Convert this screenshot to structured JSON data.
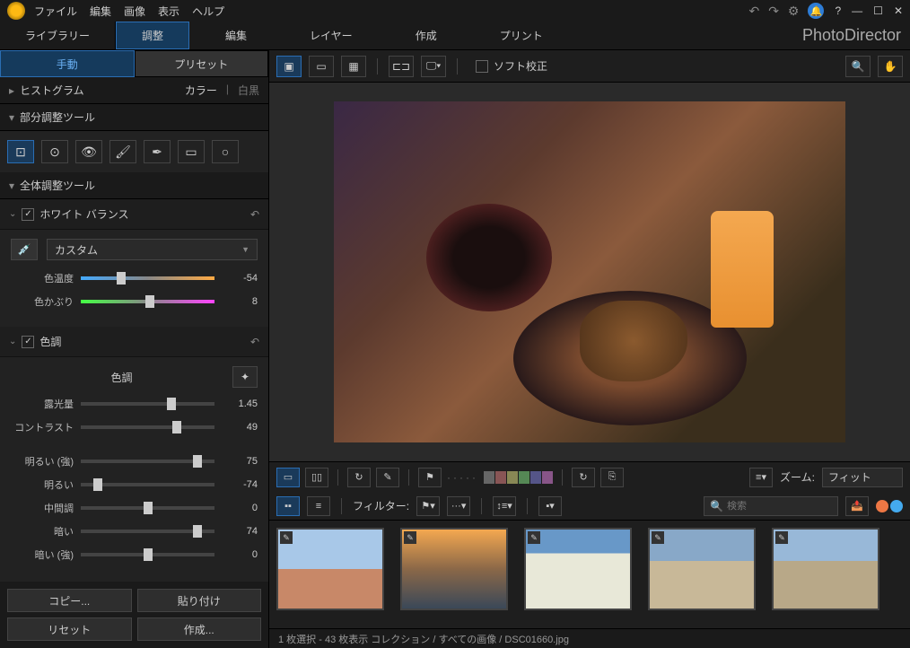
{
  "menu": {
    "file": "ファイル",
    "edit": "編集",
    "image": "画像",
    "view": "表示",
    "help": "ヘルプ"
  },
  "brand": "PhotoDirector",
  "modules": {
    "library": "ライブラリー",
    "adjustment": "調整"
  },
  "mainTabs": {
    "edit": "編集",
    "layer": "レイヤー",
    "create": "作成",
    "print": "プリント"
  },
  "subTabs": {
    "manual": "手動",
    "preset": "プリセット"
  },
  "histogram": {
    "title": "ヒストグラム",
    "color": "カラー",
    "bw": "白黒"
  },
  "regional": {
    "title": "部分調整ツール"
  },
  "global": {
    "title": "全体調整ツール"
  },
  "wb": {
    "title": "ホワイト バランス",
    "preset": "カスタム",
    "temp_label": "色温度",
    "temp_val": "-54",
    "tint_label": "色かぶり",
    "tint_val": "8"
  },
  "tone": {
    "title": "色調",
    "tone_label": "色調",
    "exposure_label": "露光量",
    "exposure_val": "1.45",
    "contrast_label": "コントラスト",
    "contrast_val": "49",
    "hi_strong_label": "明るい (強)",
    "hi_strong_val": "75",
    "hi_label": "明るい",
    "hi_val": "-74",
    "mid_label": "中間調",
    "mid_val": "0",
    "dark_label": "暗い",
    "dark_val": "74",
    "dark_strong_label": "暗い (強)",
    "dark_strong_val": "0"
  },
  "bottom": {
    "copy": "コピー...",
    "paste": "貼り付け",
    "reset": "リセット",
    "create": "作成..."
  },
  "softproof": "ソフト校正",
  "zoom": {
    "label": "ズーム:",
    "value": "フィット"
  },
  "filter": {
    "label": "フィルター:"
  },
  "search": {
    "placeholder": "検索"
  },
  "status": "1 枚選択 - 43 枚表示     コレクション / すべての画像 / DSC01660.jpg"
}
